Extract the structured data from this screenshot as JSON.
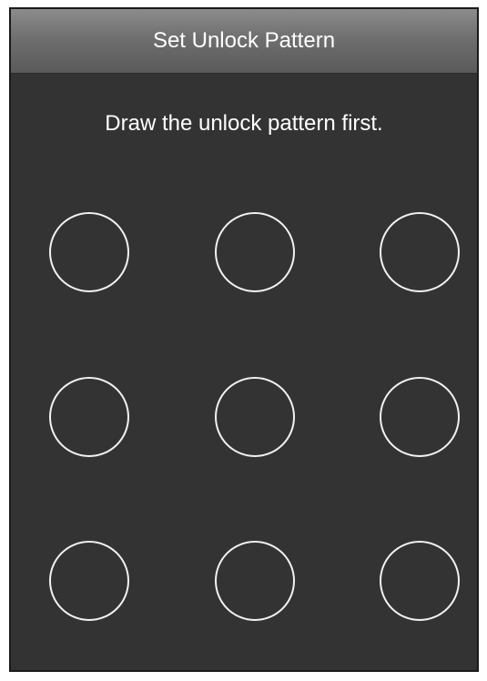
{
  "dialog": {
    "title": "Set Unlock Pattern",
    "instruction": "Draw the unlock pattern first."
  },
  "pattern_grid": {
    "rows": 3,
    "columns": 3,
    "selected_points": []
  }
}
